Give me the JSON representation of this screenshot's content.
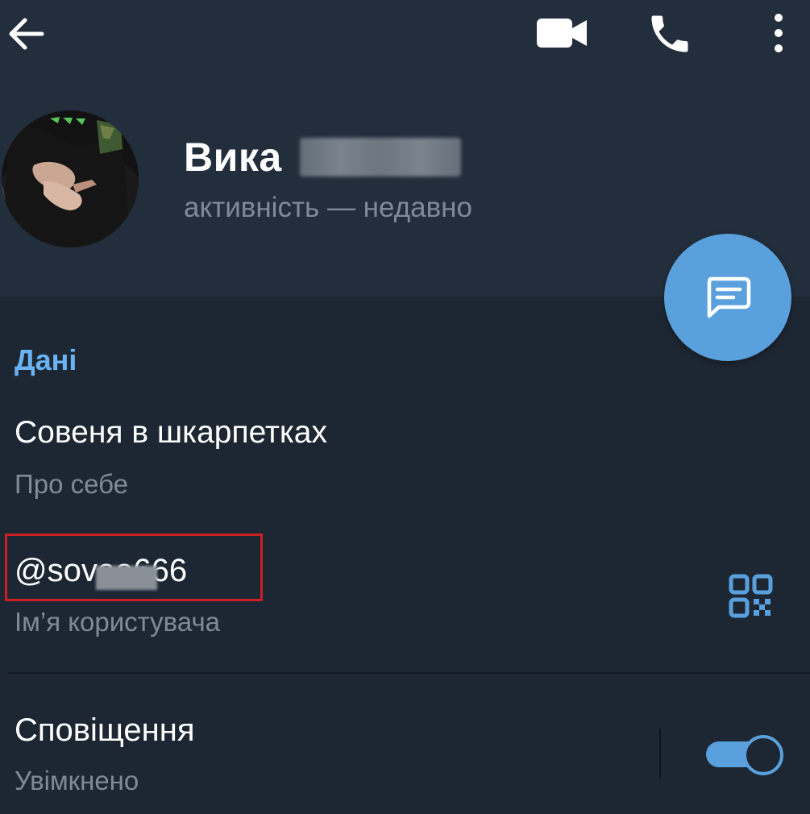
{
  "header": {
    "name": "Вика",
    "status": "активність — недавно"
  },
  "info": {
    "section_title": "Дані",
    "bio": "Совеня в шкарпетках",
    "bio_label": "Про себе",
    "username": "@sovaa666",
    "username_label": "Ім’я користувача"
  },
  "notifications": {
    "label": "Сповіщення",
    "state": "Увімкнено",
    "enabled": true
  },
  "colors": {
    "header_bg": "#232e3c",
    "body_bg": "#1d2733",
    "accent": "#5aa0dd",
    "section_title": "#6ab3f3",
    "highlight_box": "#cc1f24"
  },
  "icons": [
    "back-arrow-icon",
    "video-camera-icon",
    "phone-icon",
    "more-vertical-icon",
    "message-icon",
    "qr-code-icon"
  ]
}
